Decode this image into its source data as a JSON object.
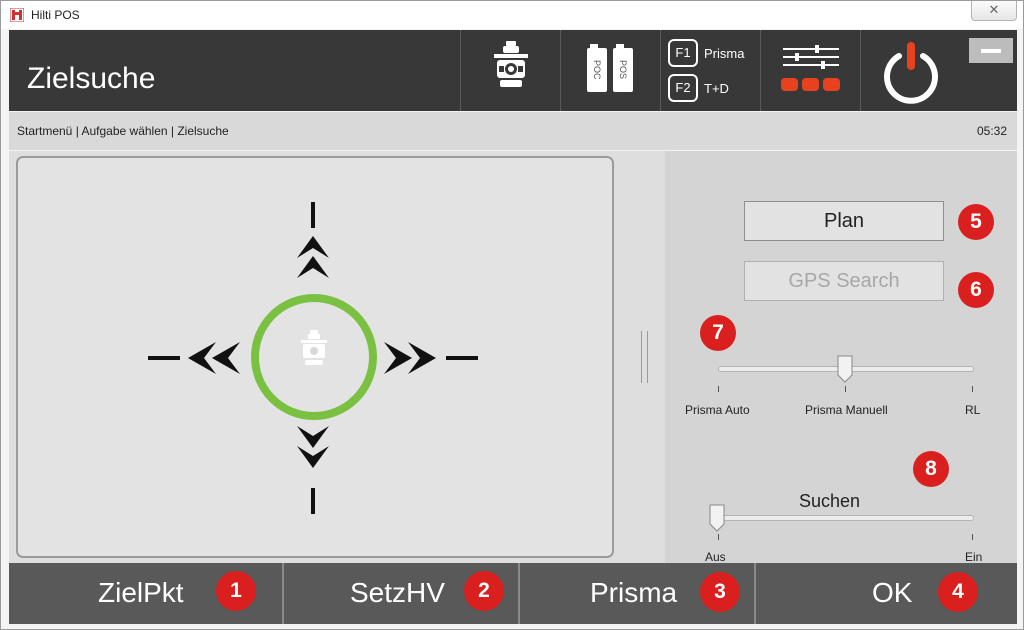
{
  "window": {
    "title": "Hilti POS",
    "close_glyph": "✕",
    "minimize_icon": "minimize-icon"
  },
  "header": {
    "page_title": "Zielsuche",
    "status_icons": [
      "instrument-icon",
      "battery-icon",
      "settings-icon",
      "power-icon"
    ],
    "battery_labels": [
      "POC",
      "POS"
    ],
    "fkeys": [
      {
        "key": "F1",
        "label": "Prisma"
      },
      {
        "key": "F2",
        "label": "T+D"
      }
    ],
    "accent_color": "#e8411e"
  },
  "breadcrumb": {
    "path": "Startmenü | Aufgabe wählen | Zielsuche",
    "time": "05:32"
  },
  "target_area": {
    "directions": [
      "up",
      "down",
      "left",
      "right"
    ],
    "ring_color": "#7ac142"
  },
  "side_panel": {
    "plan_button": "Plan",
    "gps_button": "GPS Search",
    "gps_enabled": false,
    "prism_slider": {
      "options": [
        "Prisma Auto",
        "Prisma Manuell",
        "RL"
      ],
      "selected": "Prisma Manuell"
    },
    "search_slider": {
      "title": "Suchen",
      "options": [
        "Aus",
        "Ein"
      ],
      "selected": "Aus"
    }
  },
  "badges": {
    "b1": "1",
    "b2": "2",
    "b3": "3",
    "b4": "4",
    "b5": "5",
    "b6": "6",
    "b7": "7",
    "b8": "8",
    "color": "#d9201e"
  },
  "softkeys": [
    {
      "label": "ZielPkt"
    },
    {
      "label": "SetzHV"
    },
    {
      "label": "Prisma"
    },
    {
      "label": "OK"
    }
  ]
}
